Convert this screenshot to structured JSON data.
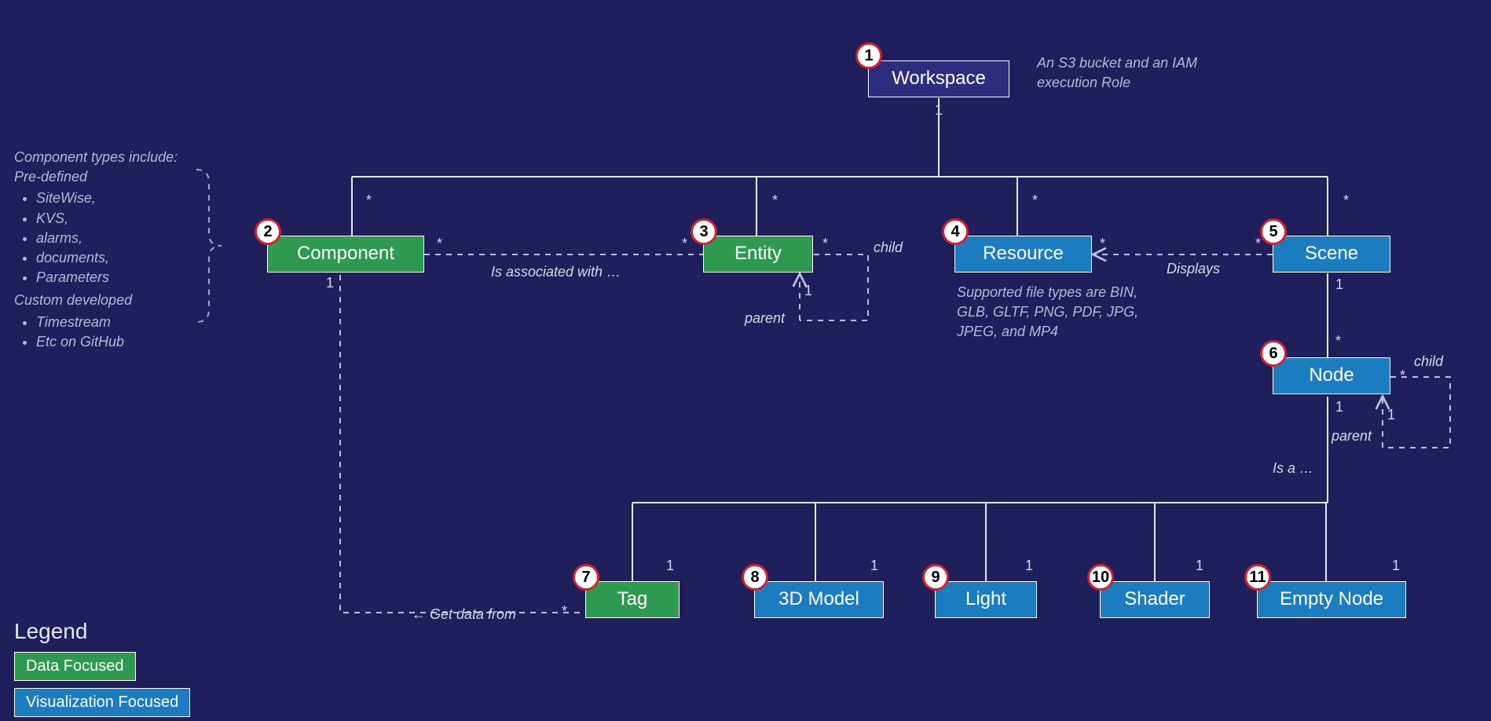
{
  "nodes": {
    "workspace": {
      "label": "Workspace",
      "num": "1"
    },
    "component": {
      "label": "Component",
      "num": "2"
    },
    "entity": {
      "label": "Entity",
      "num": "3"
    },
    "resource": {
      "label": "Resource",
      "num": "4"
    },
    "scene": {
      "label": "Scene",
      "num": "5"
    },
    "node": {
      "label": "Node",
      "num": "6"
    },
    "tag": {
      "label": "Tag",
      "num": "7"
    },
    "model3d": {
      "label": "3D Model",
      "num": "8"
    },
    "light": {
      "label": "Light",
      "num": "9"
    },
    "shader": {
      "label": "Shader",
      "num": "10"
    },
    "emptynode": {
      "label": "Empty Node",
      "num": "11"
    }
  },
  "rel": {
    "assoc": "Is associated with …",
    "displays": "Displays",
    "get_data": "← Get data from",
    "is_a": "Is a …",
    "child": "child",
    "parent": "parent"
  },
  "mult": {
    "one": "1",
    "many": "*"
  },
  "notes": {
    "workspace": "An S3 bucket and an IAM execution Role",
    "resource": "Supported file types are BIN, GLB, GLTF, PNG, PDF, JPG, JPEG, and MP4",
    "component_header": "Component types include:",
    "component_pre": "Pre-defined",
    "component_pre_items": [
      "SiteWise,",
      "KVS,",
      "alarms,",
      "documents,",
      "Parameters"
    ],
    "component_custom": "Custom developed",
    "component_custom_items": [
      "Timestream",
      "Etc on GitHub"
    ]
  },
  "legend": {
    "title": "Legend",
    "data": "Data Focused",
    "viz": "Visualization Focused"
  }
}
